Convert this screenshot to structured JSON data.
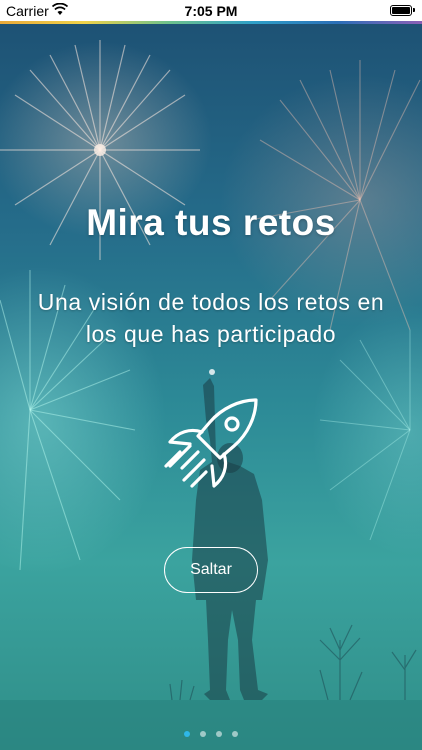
{
  "status_bar": {
    "carrier": "Carrier",
    "time": "7:05 PM",
    "wifi_icon": "wifi-icon",
    "battery_icon": "battery-icon"
  },
  "onboarding": {
    "title": "Mira tus retos",
    "subtitle": "Una visión de todos los retos en los que has participado",
    "icon": "rocket-icon",
    "skip_label": "Saltar"
  },
  "pagination": {
    "total": 4,
    "active_index": 0,
    "active_color": "#2fb7e8"
  },
  "colors": {
    "text": "#ffffff",
    "background_top": "#1d4f72",
    "background_bottom": "#2f8e88"
  }
}
